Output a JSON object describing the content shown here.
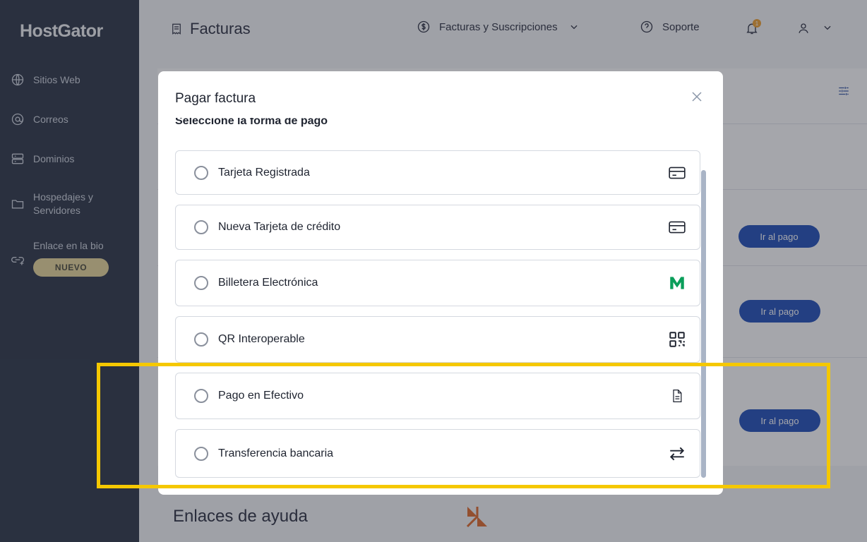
{
  "sidebar": {
    "logo": "HostGator",
    "items": [
      {
        "label": "Sitios Web",
        "icon": "globe-icon"
      },
      {
        "label": "Correos",
        "icon": "at-icon"
      },
      {
        "label": "Dominios",
        "icon": "server-icon"
      },
      {
        "label": "Hospedajes y Servidores",
        "icon": "folder-icon"
      },
      {
        "label": "Enlace en la bio",
        "icon": "link-icon"
      }
    ],
    "badge": "NUEVO"
  },
  "header": {
    "page_title": "Facturas",
    "nav_billing": "Facturas y Suscripciones",
    "nav_support": "Soporte",
    "notification_count": "1"
  },
  "background": {
    "pay_button": "Ir al pago",
    "help_title": "Enlaces de ayuda"
  },
  "modal": {
    "title": "Pagar factura",
    "subtitle": "Seleccione la forma de pago",
    "options": [
      {
        "label": "Tarjeta Registrada",
        "icon": "credit-card-icon"
      },
      {
        "label": "Nueva Tarjeta de crédito",
        "icon": "credit-card-icon"
      },
      {
        "label": "Billetera Electrónica",
        "icon": "m-wallet-logo-icon"
      },
      {
        "label": "QR Interoperable",
        "icon": "qr-code-icon"
      },
      {
        "label": "Pago en Efectivo",
        "icon": "document-icon"
      },
      {
        "label": "Transferencia bancaria",
        "icon": "transfer-arrows-icon"
      }
    ]
  },
  "colors": {
    "sidebar_bg": "#2b3546",
    "highlight": "#f5c800",
    "wallet_green": "#0a9e5a",
    "primary_button": "#1f4fb8"
  }
}
